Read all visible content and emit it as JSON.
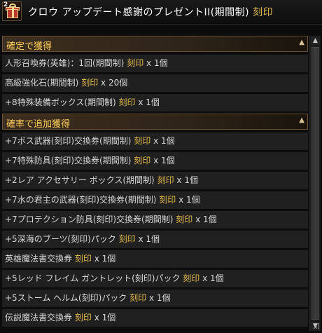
{
  "window": {
    "badge_count": "2",
    "title_main": "クロウ アップデート感謝のプレゼントII(期間制)",
    "title_attr": "刻印"
  },
  "sections": [
    {
      "label": "確定で獲得",
      "items": [
        {
          "name": "人形召喚券(英雄)：1回(期間制)",
          "attr": "刻印",
          "qty": "x 1個"
        },
        {
          "name": "高級強化石(期間制)",
          "attr": "刻印",
          "qty": "x 20個"
        },
        {
          "name": "+8特殊装備ボックス(期間制)",
          "attr": "刻印",
          "qty": "x 1個"
        }
      ]
    },
    {
      "label": "確率で追加獲得",
      "items": [
        {
          "name": "+7ボス武器(刻印)交換券(期間制)",
          "attr": "刻印",
          "qty": "x 1個"
        },
        {
          "name": "+7特殊防具(刻印)交換券(期間制)",
          "attr": "刻印",
          "qty": "x 1個"
        },
        {
          "name": "+2レア アクセサリー ボックス(期間制)",
          "attr": "刻印",
          "qty": "x 1個"
        },
        {
          "name": "+7水の君主の武器(刻印)交換券(期間制)",
          "attr": "刻印",
          "qty": "x 1個"
        },
        {
          "name": "+7プロテクション防具(刻印)交換券(期間制)",
          "attr": "刻印",
          "qty": "x 1個"
        },
        {
          "name": "+5深海のブーツ(刻印)パック",
          "attr": "刻印",
          "qty": "x 1個"
        },
        {
          "name": "英雄魔法書交換券",
          "attr": "刻印",
          "qty": "x 1個"
        },
        {
          "name": "+5レッド フレイム ガントレット(刻印)パック",
          "attr": "刻印",
          "qty": "x 1個"
        },
        {
          "name": "+5ストーム ヘルム(刻印)パック",
          "attr": "刻印",
          "qty": "x 1個"
        },
        {
          "name": "伝説魔法書交換券",
          "attr": "刻印",
          "qty": "x 1個"
        }
      ]
    }
  ],
  "icons": {
    "gift": "gift-box-icon",
    "section_toggle": "chevron-up-icon",
    "scroll_up": "arrow-up-icon",
    "scroll_down": "arrow-down-icon",
    "resize": "resize-grip-icon"
  },
  "colors": {
    "background": "#0c0c0c",
    "row_background": "#202020",
    "header_text": "#ffcf5c",
    "attribute_text": "#e0b94a",
    "item_text": "#d8d8d8"
  }
}
